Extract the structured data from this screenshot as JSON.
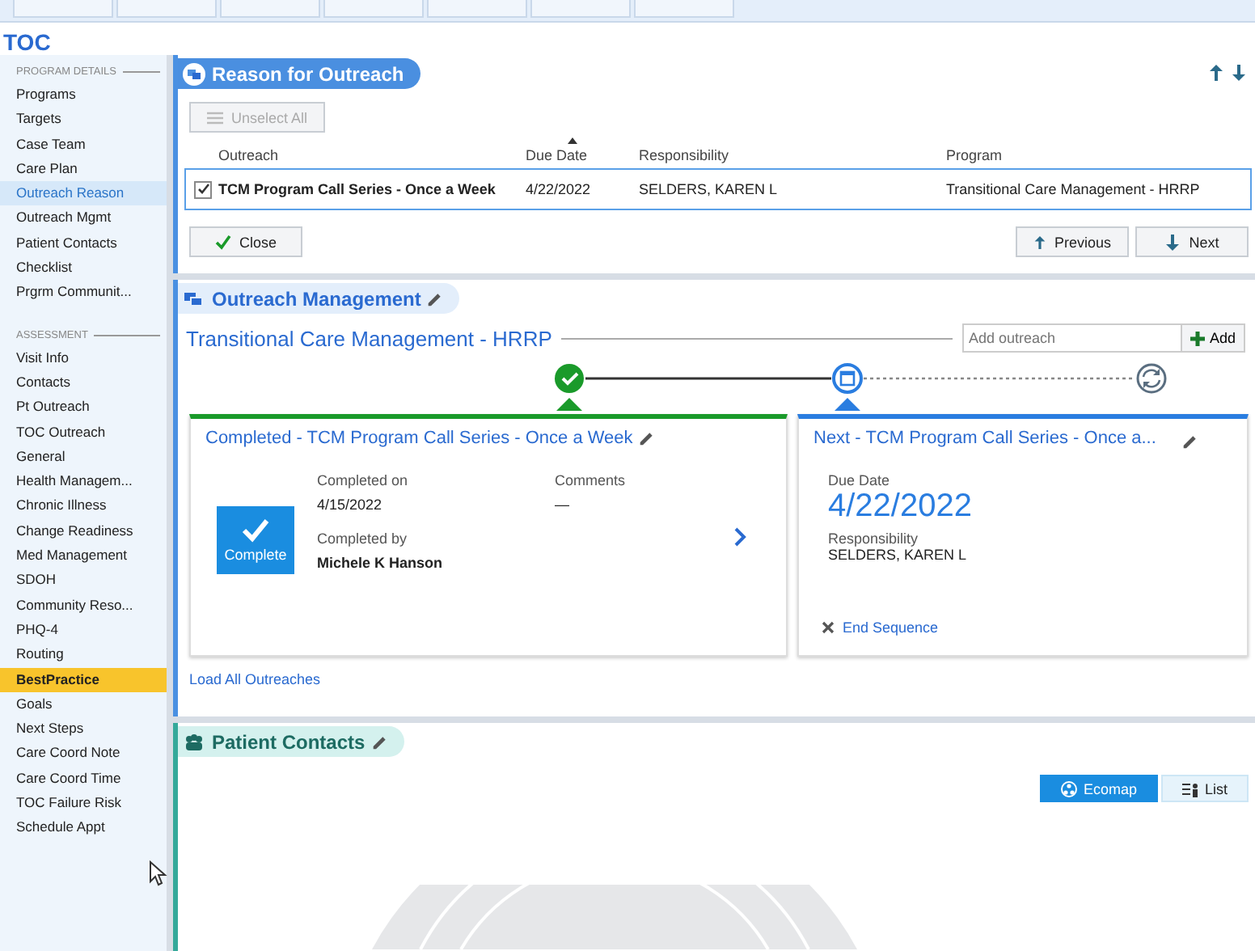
{
  "page": {
    "title": "TOC"
  },
  "sidebar": {
    "sections": [
      {
        "heading": "PROGRAM DETAILS",
        "items": [
          {
            "label": "Programs",
            "selected": false,
            "flagged": false
          },
          {
            "label": "Targets",
            "selected": false,
            "flagged": false
          },
          {
            "label": "Case Team",
            "selected": false,
            "flagged": false
          },
          {
            "label": "Care Plan",
            "selected": false,
            "flagged": false
          },
          {
            "label": "Outreach Reason",
            "selected": true,
            "flagged": false
          },
          {
            "label": "Outreach Mgmt",
            "selected": false,
            "flagged": false
          },
          {
            "label": "Patient Contacts",
            "selected": false,
            "flagged": false
          },
          {
            "label": "Checklist",
            "selected": false,
            "flagged": false
          },
          {
            "label": "Prgrm Communit...",
            "selected": false,
            "flagged": false
          }
        ]
      },
      {
        "heading": "ASSESSMENT",
        "items": [
          {
            "label": "Visit Info",
            "selected": false,
            "flagged": false
          },
          {
            "label": "Contacts",
            "selected": false,
            "flagged": false
          },
          {
            "label": "Pt Outreach",
            "selected": false,
            "flagged": false
          },
          {
            "label": "TOC Outreach",
            "selected": false,
            "flagged": false
          },
          {
            "label": "General",
            "selected": false,
            "flagged": false
          },
          {
            "label": "Health Managem...",
            "selected": false,
            "flagged": false
          },
          {
            "label": "Chronic Illness",
            "selected": false,
            "flagged": false
          },
          {
            "label": "Change Readiness",
            "selected": false,
            "flagged": false
          },
          {
            "label": "Med Management",
            "selected": false,
            "flagged": false
          },
          {
            "label": "SDOH",
            "selected": false,
            "flagged": false
          },
          {
            "label": "Community Reso...",
            "selected": false,
            "flagged": false
          },
          {
            "label": "PHQ-4",
            "selected": false,
            "flagged": false
          },
          {
            "label": "Routing",
            "selected": false,
            "flagged": false
          },
          {
            "label": "BestPractice",
            "selected": false,
            "flagged": true
          },
          {
            "label": "Goals",
            "selected": false,
            "flagged": false
          },
          {
            "label": "Next Steps",
            "selected": false,
            "flagged": false
          },
          {
            "label": "Care Coord Note",
            "selected": false,
            "flagged": false
          },
          {
            "label": "Care Coord Time",
            "selected": false,
            "flagged": false
          },
          {
            "label": "TOC Failure Risk",
            "selected": false,
            "flagged": false
          },
          {
            "label": "Schedule Appt",
            "selected": false,
            "flagged": false
          }
        ]
      }
    ]
  },
  "reason": {
    "title": "Reason for Outreach",
    "unselect_all": {
      "label": "Unselect All",
      "disabled": true
    },
    "columns": [
      {
        "label": "Outreach",
        "sorted": false
      },
      {
        "label": "Due Date",
        "sorted": true
      },
      {
        "label": "Responsibility",
        "sorted": false
      },
      {
        "label": "Program",
        "sorted": false
      }
    ],
    "rows": [
      {
        "checked": true,
        "selected": true,
        "outreach": "TCM Program Call Series - Once a Week",
        "due_date": "4/22/2022",
        "responsibility": "SELDERS, KAREN L",
        "program": "Transitional Care Management - HRRP"
      }
    ],
    "close": "Close",
    "previous": "Previous",
    "next": "Next"
  },
  "outreach": {
    "title": "Outreach Management",
    "program": "Transitional Care Management - HRRP",
    "add_field": {
      "placeholder": "Add outreach"
    },
    "add_button": "Add",
    "steps": [
      {
        "kind": "completed"
      },
      {
        "kind": "current"
      },
      {
        "kind": "pending"
      }
    ],
    "cards": [
      {
        "kind": "completed",
        "title": "Completed - TCM Program Call Series - Once a Week",
        "badge": "Complete",
        "completed_on_label": "Completed on",
        "completed_on": "4/15/2022",
        "completed_by_label": "Completed by",
        "completed_by": "Michele K Hanson",
        "comments_label": "Comments",
        "comments": "—"
      },
      {
        "kind": "next",
        "title": "Next - TCM Program Call Series - Once a...",
        "due_date_label": "Due Date",
        "due_date": "4/22/2022",
        "responsibility_label": "Responsibility",
        "responsibility": "SELDERS, KAREN L",
        "end_sequence": "End Sequence"
      }
    ],
    "load_all": "Load All Outreaches"
  },
  "contacts": {
    "title": "Patient Contacts",
    "views": [
      {
        "label": "Ecomap",
        "selected": true
      },
      {
        "label": "List",
        "selected": false
      }
    ]
  }
}
